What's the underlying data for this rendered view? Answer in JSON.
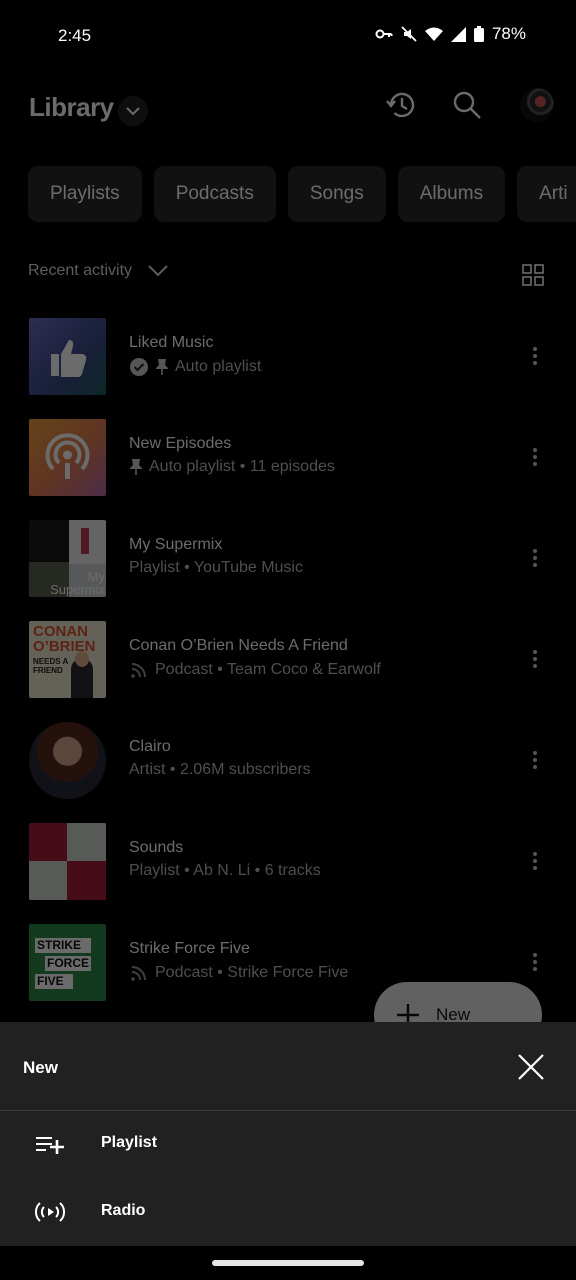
{
  "status_bar": {
    "time": "2:45",
    "battery": "78%",
    "icons": [
      "vpn-key-icon",
      "mute-icon",
      "wifi-icon",
      "signal-icon",
      "battery-icon"
    ]
  },
  "header": {
    "title": "Library",
    "icons": [
      "chevron-down-icon",
      "history-icon",
      "search-icon",
      "avatar"
    ]
  },
  "chips": [
    "Playlists",
    "Podcasts",
    "Songs",
    "Albums",
    "Arti"
  ],
  "sort": {
    "label": "Recent activity"
  },
  "items": [
    {
      "title": "Liked Music",
      "subtitle": "Auto playlist",
      "badges": [
        "check-icon",
        "pin-icon"
      ],
      "thumb": "thumbs-up"
    },
    {
      "title": "New Episodes",
      "subtitle": "Auto playlist • 11 episodes",
      "badges": [
        "pin-icon"
      ],
      "thumb": "podcast"
    },
    {
      "title": "My Supermix",
      "subtitle": "Playlist • YouTube Music",
      "badges": [],
      "thumb": "supermix",
      "thumb_text": "My Supermix"
    },
    {
      "title": "Conan O’Brien Needs A Friend",
      "subtitle": "Podcast • Team Coco & Earwolf",
      "badges": [
        "podcast-rss-icon"
      ],
      "thumb": "conan",
      "thumb_text": "CONAN O’BRIEN",
      "thumb_sub": "NEEDS A FRIEND"
    },
    {
      "title": "Clairo",
      "subtitle": "Artist • 2.06M subscribers",
      "badges": [],
      "thumb": "artist"
    },
    {
      "title": "Sounds",
      "subtitle": "Playlist • Ab N. Li • 6 tracks",
      "badges": [],
      "thumb": "sounds"
    },
    {
      "title": "Strike Force Five",
      "subtitle": "Podcast • Strike Force Five",
      "badges": [
        "podcast-rss-icon"
      ],
      "thumb": "strike",
      "thumb_text": [
        "STRIKE",
        "FORCE",
        "FIVE"
      ]
    }
  ],
  "fab": {
    "label": "New"
  },
  "sheet": {
    "title": "New",
    "options": [
      {
        "label": "Playlist",
        "icon": "playlist-add-icon"
      },
      {
        "label": "Radio",
        "icon": "radio-icon"
      }
    ]
  }
}
